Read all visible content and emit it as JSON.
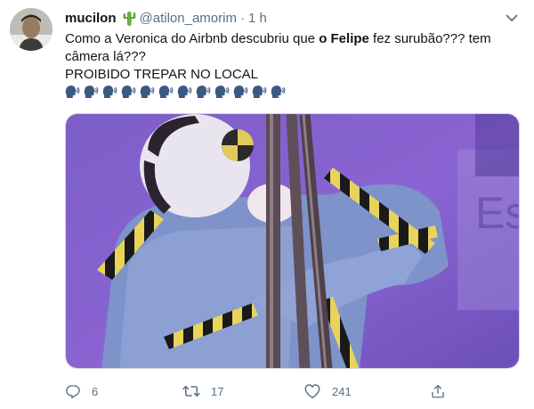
{
  "tweet": {
    "author": {
      "display_name": "mucilon",
      "badge_icon": "cactus-emoji",
      "handle": "@atilon_amorim",
      "separator": "·",
      "time": "1 h"
    },
    "text": {
      "part1": "Como a Veronica do Airbnb descubriu que ",
      "bold": "o Felipe",
      "part2": " fez surubão??? tem câmera lá???",
      "line2": "PROIBIDO TREPAR NO LOCAL",
      "emoji_name": "speaking-head-emoji",
      "emoji_count": 12
    },
    "media": {
      "type": "image",
      "overlay_text": "Es"
    },
    "actions": {
      "reply_count": "6",
      "retweet_count": "17",
      "like_count": "241"
    },
    "colors": {
      "text_primary": "#0f1419",
      "text_secondary": "#5b7083",
      "border": "#cfd9de"
    }
  }
}
